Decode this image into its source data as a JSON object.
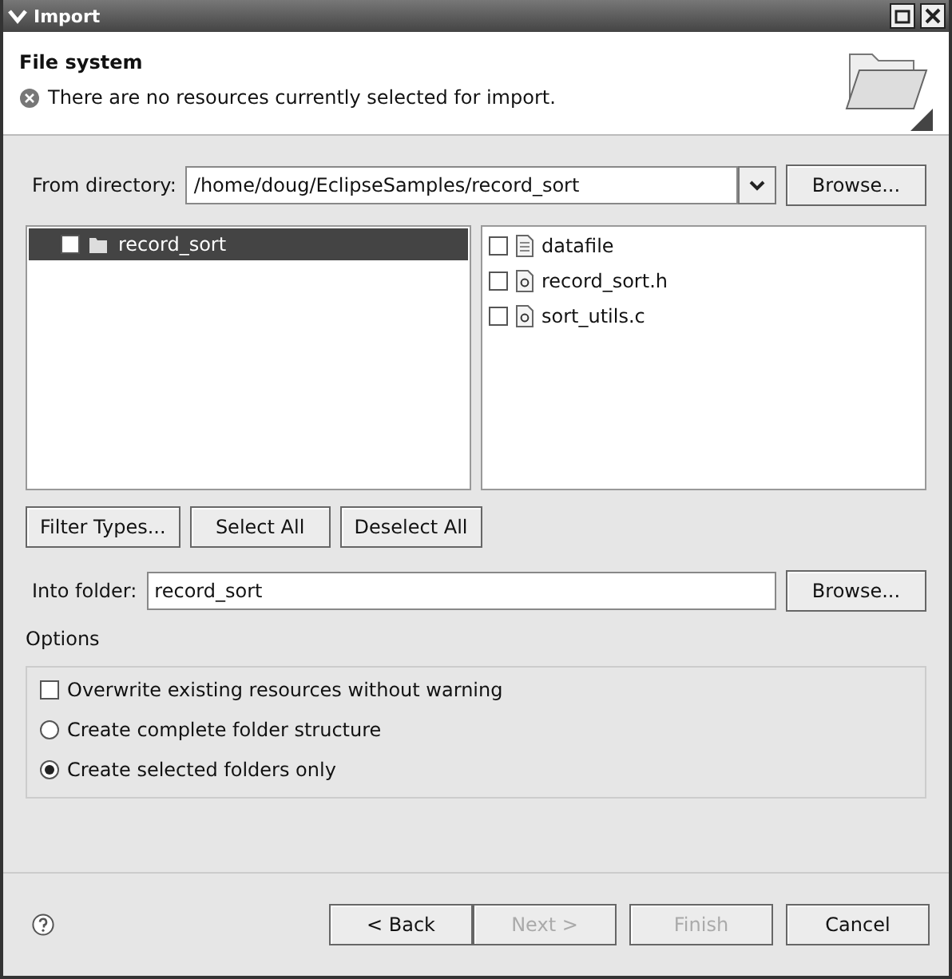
{
  "window": {
    "title": "Import"
  },
  "header": {
    "title": "File system",
    "message": "There are no resources currently selected for import."
  },
  "from_directory": {
    "label": "From directory:",
    "value": "/home/doug/EclipseSamples/record_sort",
    "browse": "Browse..."
  },
  "folders": [
    {
      "name": "record_sort",
      "checked": false,
      "selected": true
    }
  ],
  "files": [
    {
      "name": "datafile",
      "kind": "data",
      "checked": false
    },
    {
      "name": "record_sort.h",
      "kind": "source",
      "checked": false
    },
    {
      "name": "sort_utils.c",
      "kind": "source",
      "checked": false
    }
  ],
  "selection_buttons": [
    "Filter Types...",
    "Select All",
    "Deselect All"
  ],
  "into_folder": {
    "label": "Into folder:",
    "value": "record_sort",
    "browse": "Browse..."
  },
  "options": {
    "title": "Options",
    "items": [
      {
        "kind": "checkbox",
        "label": "Overwrite existing resources without warning",
        "checked": false
      },
      {
        "kind": "radio",
        "label": "Create complete folder structure",
        "selected": false
      },
      {
        "kind": "radio",
        "label": "Create selected folders only",
        "selected": true
      }
    ]
  },
  "footer_buttons": [
    {
      "label": "< Back",
      "disabled": false
    },
    {
      "label": "Next >",
      "disabled": true
    },
    {
      "label": "Finish",
      "disabled": true
    },
    {
      "label": "Cancel",
      "disabled": false
    }
  ]
}
